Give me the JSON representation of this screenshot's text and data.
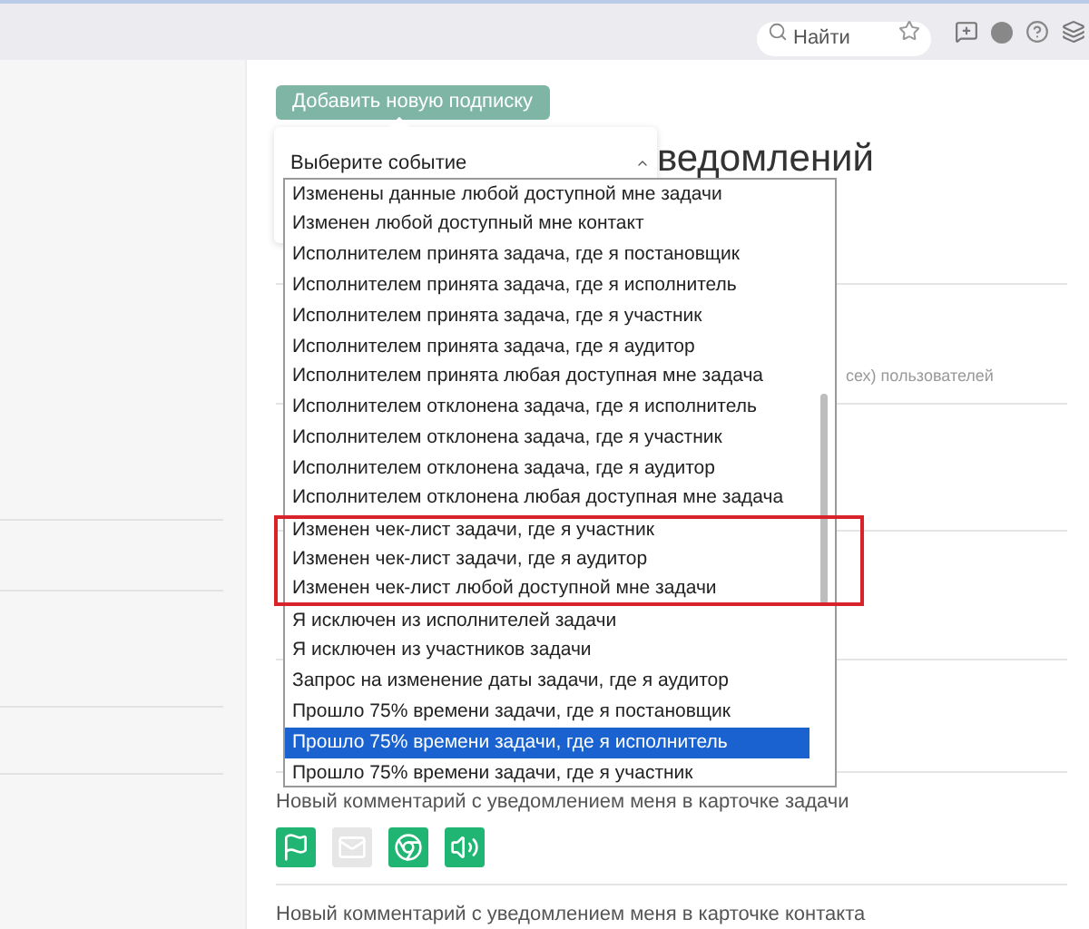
{
  "top_bar": {
    "search": {
      "placeholder": "Найти"
    }
  },
  "add_button": "Добавить новую подписку",
  "heading": "ведомлений",
  "background_note": "сех) пользователей",
  "event_select": {
    "label": "Выберите событие",
    "expanded": true,
    "options": [
      {
        "label": "Изменены данные любой доступной мне задачи",
        "selected": false,
        "marked": false
      },
      {
        "label": "Изменен любой доступный мне контакт",
        "selected": false,
        "marked": false
      },
      {
        "label": "Исполнителем принята задача, где я постановщик",
        "selected": false,
        "marked": false
      },
      {
        "label": "Исполнителем принята задача, где я исполнитель",
        "selected": false,
        "marked": false
      },
      {
        "label": "Исполнителем принята задача, где я участник",
        "selected": false,
        "marked": false
      },
      {
        "label": "Исполнителем принята задача, где я аудитор",
        "selected": false,
        "marked": false
      },
      {
        "label": "Исполнителем принята любая доступная мне задача",
        "selected": false,
        "marked": false
      },
      {
        "label": "Исполнителем отклонена задача, где я исполнитель",
        "selected": false,
        "marked": false
      },
      {
        "label": "Исполнителем отклонена задача, где я участник",
        "selected": false,
        "marked": false
      },
      {
        "label": "Исполнителем отклонена задача, где я аудитор",
        "selected": false,
        "marked": false
      },
      {
        "label": "Исполнителем отклонена любая доступная мне задача",
        "selected": false,
        "marked": false
      },
      {
        "label": "Изменен чек-лист задачи, где я участник",
        "selected": false,
        "marked": true
      },
      {
        "label": "Изменен чек-лист задачи, где я аудитор",
        "selected": false,
        "marked": true
      },
      {
        "label": "Изменен чек-лист любой доступной мне задачи",
        "selected": false,
        "marked": true
      },
      {
        "label": "Я исключен из исполнителей задачи",
        "selected": false,
        "marked": false
      },
      {
        "label": "Я исключен из участников задачи",
        "selected": false,
        "marked": false
      },
      {
        "label": "Запрос на изменение даты задачи, где я аудитор",
        "selected": false,
        "marked": false
      },
      {
        "label": "Прошло 75% времени задачи, где я постановщик",
        "selected": false,
        "marked": false
      },
      {
        "label": "Прошло 75% времени задачи, где я исполнитель",
        "selected": true,
        "marked": false
      },
      {
        "label": "Прошло 75% времени задачи, где я участник",
        "selected": false,
        "marked": false
      }
    ]
  },
  "sections": [
    {
      "title": "Новый комментарий с уведомлением меня в карточке задачи",
      "channels": [
        {
          "kind": "flag",
          "on": true
        },
        {
          "kind": "mail",
          "on": false
        },
        {
          "kind": "browser",
          "on": true
        },
        {
          "kind": "sound",
          "on": true
        }
      ]
    },
    {
      "title": "Новый комментарий с уведомлением меня в карточке контакта"
    }
  ]
}
